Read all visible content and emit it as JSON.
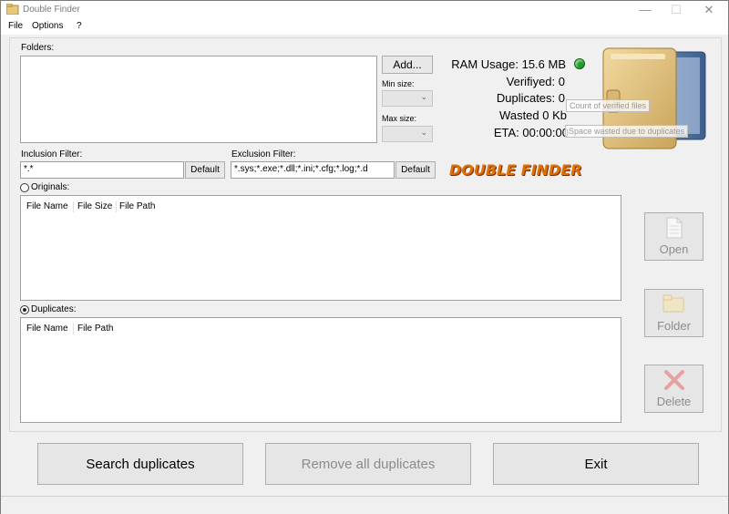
{
  "window": {
    "title": "Double Finder",
    "controls": {
      "minimize": "—",
      "maximize": "☐",
      "close": "✕"
    }
  },
  "menu": {
    "items": [
      {
        "label": "File"
      },
      {
        "label": "Options"
      },
      {
        "label": "?"
      }
    ]
  },
  "folders": {
    "label": "Folders:",
    "add_button": "Add...",
    "min_size_label": "Min size:",
    "max_size_label": "Max size:",
    "min_size_value": "",
    "max_size_value": ""
  },
  "stats": {
    "ram_usage": "RAM Usage: 15.6 MB",
    "verified": "Verifiyed: 0",
    "duplicates": "Duplicates: 0",
    "wasted": "Wasted 0 Kb",
    "eta": "ETA: 00:00:00",
    "ram_indicator_color": "#1f9c2a"
  },
  "tooltips": {
    "verified": "Count of verified files",
    "wasted": "Space wasted due to duplicates"
  },
  "logo": {
    "text": "DOUBLE FINDER"
  },
  "filters": {
    "inclusion_label": "Inclusion Filter:",
    "inclusion_value": "*.*",
    "inclusion_default": "Default",
    "exclusion_label": "Exclusion Filter:",
    "exclusion_value": "*.sys;*.exe;*.dll;*.ini;*.cfg;*.log;*.d",
    "exclusion_default": "Default"
  },
  "originals": {
    "label": "Originals:",
    "selected": false,
    "columns": [
      "File Name",
      "File Size",
      "File Path"
    ]
  },
  "duplicates": {
    "label": "Duplicates:",
    "selected": true,
    "columns": [
      "File Name",
      "File Path"
    ]
  },
  "side_buttons": {
    "open": "Open",
    "folder": "Folder",
    "delete": "Delete"
  },
  "actions": {
    "search": "Search duplicates",
    "remove_all": "Remove all duplicates",
    "exit": "Exit"
  },
  "colors": {
    "accent_orange": "#e07000",
    "disabled_text": "#8c8c8c",
    "delete_x": "#e8a0a0"
  }
}
